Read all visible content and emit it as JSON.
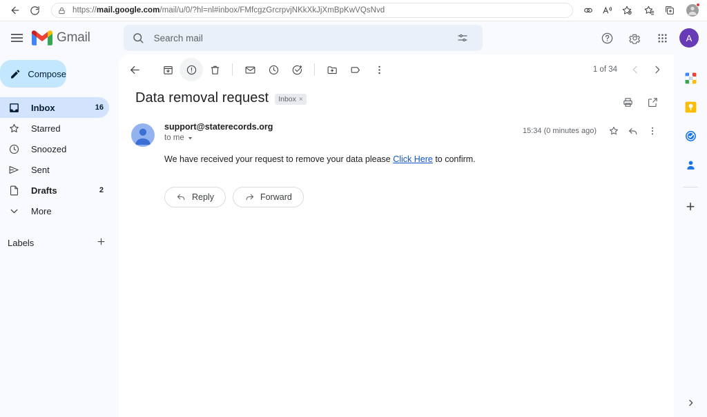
{
  "browser": {
    "back_tooltip": "Back",
    "reload_tooltip": "Refresh",
    "url_prefix": "https://",
    "url_domain": "mail.google.com",
    "url_rest": "/mail/u/0/?hl=nl#inbox/FMfcgzGrcrpvjNKkXkJjXmBpKwVQsNvd",
    "icons": [
      "split-screen-icon",
      "read-aloud-icon",
      "add-favorite-icon",
      "favorites-icon",
      "collections-icon",
      "browser-profile-icon"
    ]
  },
  "gmail": {
    "brand": "Gmail",
    "search": {
      "placeholder": "Search mail",
      "value": ""
    },
    "header_icons": [
      "help-icon",
      "settings-icon",
      "google-apps-icon"
    ],
    "account_initial": "A"
  },
  "sidebar": {
    "compose_label": "Compose",
    "items": [
      {
        "label": "Inbox",
        "count": "16",
        "icon": "inbox-icon",
        "active": true
      },
      {
        "label": "Starred",
        "count": "",
        "icon": "star-icon",
        "active": false
      },
      {
        "label": "Snoozed",
        "count": "",
        "icon": "clock-icon",
        "active": false
      },
      {
        "label": "Sent",
        "count": "",
        "icon": "send-icon",
        "active": false
      },
      {
        "label": "Drafts",
        "count": "2",
        "icon": "draft-icon",
        "active": false
      },
      {
        "label": "More",
        "count": "",
        "icon": "chevron-down-icon",
        "active": false
      }
    ],
    "labels_title": "Labels",
    "labels_add": "+"
  },
  "toolbar": {
    "icons": [
      "back-to-inbox-icon",
      "archive-icon",
      "report-spam-icon",
      "delete-icon",
      "mark-unread-icon",
      "snooze-icon",
      "add-to-tasks-icon",
      "move-to-icon",
      "labels-icon",
      "more-options-icon"
    ],
    "pager_text": "1 of 34",
    "prev_label": "Newer",
    "next_label": "Older"
  },
  "email": {
    "subject": "Data removal request",
    "label_chip": "Inbox",
    "label_chip_remove": "×",
    "print_icon": "print-icon",
    "popout_icon": "open-in-new-window-icon",
    "sender": "support@staterecords.org",
    "recipient": "to me",
    "timestamp": "15:34 (0 minutes ago)",
    "body_before": "We have received your request to remove your data please ",
    "body_link": "Click Here",
    "body_after": " to confirm.",
    "reply_label": "Reply",
    "forward_label": "Forward"
  },
  "side_panel": {
    "apps": [
      "google-calendar-icon",
      "google-keep-icon",
      "google-tasks-icon",
      "google-contacts-icon"
    ],
    "add_label": "+",
    "expand_label": "›"
  },
  "colors": {
    "accent_blue": "#1a73e8",
    "compose_bg": "#c2e7ff",
    "active_nav_bg": "#d3e3fd",
    "search_bg": "#eaf0fa",
    "app_bg": "#f8fafd",
    "link": "#1155cc",
    "avatar_purple": "#673ab7"
  }
}
